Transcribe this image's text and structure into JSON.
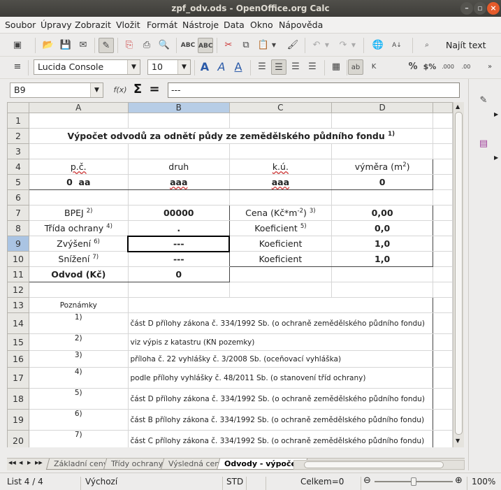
{
  "window": {
    "title": "zpf_odv.ods - OpenOffice.org Calc"
  },
  "menu": [
    "Soubor",
    "Úpravy",
    "Zobrazit",
    "Vložit",
    "Formát",
    "Nástroje",
    "Data",
    "Okno",
    "Nápověda"
  ],
  "toolbar": {
    "find_text": "Najít text"
  },
  "format": {
    "font_name": "Lucida Console",
    "font_size": "10"
  },
  "formula": {
    "cell_ref": "B9",
    "fx": "f(x)",
    "sigma": "Σ",
    "equals": "=",
    "content": "---"
  },
  "columns": [
    "A",
    "B",
    "C",
    "D"
  ],
  "rows": [
    "1",
    "2",
    "3",
    "4",
    "5",
    "6",
    "7",
    "8",
    "9",
    "10",
    "11",
    "12",
    "13",
    "14",
    "15",
    "16",
    "17",
    "18",
    "19",
    "20"
  ],
  "sheet": {
    "title": "Výpočet odvodů za odnětí půdy ze zemědělského půdního fondu",
    "title_sup": "1)",
    "hdr_pc": "p.č.",
    "hdr_druh": "druh",
    "hdr_ku": "k.ú.",
    "hdr_vymera": "výměra (m",
    "hdr_vymera_sup": "2",
    "hdr_vymera_end": ")",
    "v_pc": "0  aa",
    "v_druh": "aaa",
    "v_ku": "aaa",
    "v_vymera": "0",
    "bpej": "BPEJ",
    "bpej_sup": "2)",
    "bpej_val": "00000",
    "cena": "Cena (Kč*m",
    "cena_sup1": "-2",
    "cena_end": ")",
    "cena_sup2": "3)",
    "cena_val": "0,00",
    "trida": "Třída ochrany",
    "trida_sup": "4)",
    "trida_val": ".",
    "koef1": "Koeficient",
    "koef1_sup": "5)",
    "koef1_val": "0,0",
    "zvyseni": "Zvýšení",
    "zvyseni_sup": "6)",
    "zvyseni_val": "---",
    "koef2": "Koeficient",
    "koef2_val": "1,0",
    "snizeni": "Snížení",
    "snizeni_sup": "7)",
    "snizeni_val": "---",
    "koef3": "Koeficient",
    "koef3_val": "1,0",
    "odvod": "Odvod (Kč)",
    "odvod_val": "0",
    "poznamky": "Poznámky"
  },
  "notes": [
    {
      "num": "1)",
      "text": "část D přílohy zákona č. 334/1992 Sb. (o ochraně zemědělského půdního fondu)"
    },
    {
      "num": "2)",
      "text": "viz výpis z katastru (KN pozemky)"
    },
    {
      "num": "3)",
      "text": "příloha č. 22 vyhlášky č. 3/2008 Sb. (oceňovací vyhláška)"
    },
    {
      "num": "4)",
      "text": "podle přílohy vyhlášky č. 48/2011 Sb. (o stanovení tříd ochrany)"
    },
    {
      "num": "5)",
      "text": "část D přílohy zákona č. 334/1992 Sb. (o ochraně zemědělského půdního fondu)"
    },
    {
      "num": "6)",
      "text": "část B přílohy zákona č. 334/1992 Sb. (o ochraně zemědělského půdního fondu)"
    },
    {
      "num": "7)",
      "text": "část C přílohy zákona č. 334/1992 Sb. (o ochraně zemědělského půdního fondu)"
    }
  ],
  "tabs": [
    "Základní ceny",
    "Třídy ochrany",
    "Výsledná cena",
    "Odvody - výpočet"
  ],
  "status": {
    "sheet": "List 4 / 4",
    "style": "Výchozí",
    "mode": "STD",
    "sum": "Celkem=0",
    "zoom": "100%"
  }
}
